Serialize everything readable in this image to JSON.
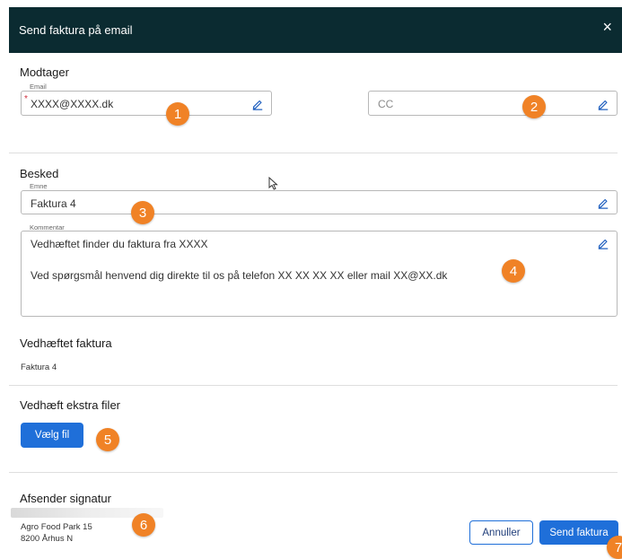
{
  "dialog": {
    "title": "Send faktura på email",
    "close_glyph": "×"
  },
  "recipient": {
    "section_title": "Modtager",
    "email_label": "Email",
    "email_value": "XXXX@XXXX.dk",
    "required_mark": "*",
    "cc_placeholder": "CC"
  },
  "message": {
    "section_title": "Besked",
    "subject_label": "Emne",
    "subject_value": "Faktura 4",
    "comment_label": "Kommentar",
    "comment_line1": "Vedhæftet finder du faktura fra XXXX",
    "comment_line2": "Ved spørgsmål henvend dig direkte til os på telefon XX XX XX XX eller mail XX@XX.dk"
  },
  "attachment": {
    "section_title": "Vedhæftet faktura",
    "file_name": "Faktura 4"
  },
  "extra_files": {
    "section_title": "Vedhæft ekstra filer",
    "choose_file_label": "Vælg fil"
  },
  "signature": {
    "section_title": "Afsender signatur",
    "address_line1": "Agro Food Park 15",
    "address_line2": "8200 Århus N"
  },
  "footer": {
    "cancel_label": "Annuller",
    "send_label": "Send faktura"
  },
  "badges": [
    "1",
    "2",
    "3",
    "4",
    "5",
    "6",
    "7"
  ],
  "colors": {
    "header_bg": "#0b2b31",
    "primary": "#1f6fd9",
    "badge": "#f08226",
    "required": "#d0303d"
  },
  "icons": {
    "edit": "pencil-icon",
    "close": "close-icon",
    "cursor": "mouse-pointer-icon"
  }
}
